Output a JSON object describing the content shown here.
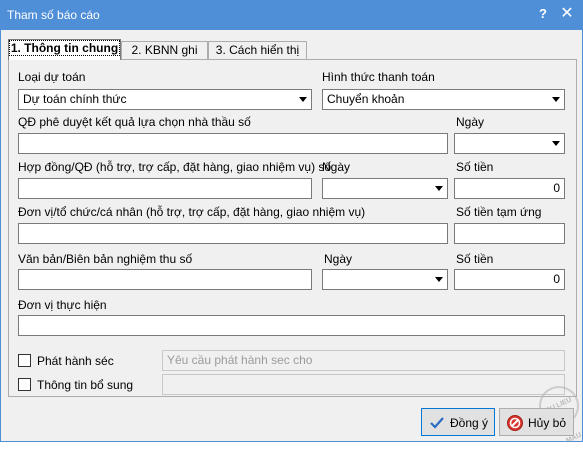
{
  "window": {
    "title": "Tham số báo cáo",
    "help_glyph": "?",
    "close_glyph": "✕",
    "title_color": "#4f8fd8"
  },
  "tabs": [
    {
      "label": "1. Thông tin chung",
      "active": true
    },
    {
      "label": "2. KBNN ghi",
      "active": false
    },
    {
      "label": "3. Cách hiển thị",
      "active": false
    }
  ],
  "form": {
    "loai_du_toan": {
      "label": "Loại dự toán",
      "value": "Dự toán chính thức"
    },
    "hinh_thuc_tt": {
      "label": "Hình thức thanh toán",
      "value": "Chuyển khoản"
    },
    "qd_phe_duyet": {
      "label": "QĐ phê duyệt kết quả lựa chọn nhà thầu số",
      "value": ""
    },
    "qd_ngay": {
      "label": "Ngày",
      "value": ""
    },
    "hop_dong": {
      "label": "Hợp đồng/QĐ (hỗ trợ, trợ cấp, đặt hàng, giao nhiệm vụ) số",
      "value": ""
    },
    "hop_dong_ngay": {
      "label": "Ngày",
      "value": ""
    },
    "hop_dong_so_tien": {
      "label": "Số tiền",
      "value": "0"
    },
    "don_vi_to_chuc": {
      "label": "Đơn vị/tổ chức/cá nhân (hỗ trợ, trợ cấp, đặt hàng, giao nhiệm vụ)",
      "value": ""
    },
    "so_tien_tam_ung": {
      "label": "Số tiền tạm ứng",
      "value": ""
    },
    "van_ban": {
      "label": "Văn bản/Biên bản nghiệm thu số",
      "value": ""
    },
    "van_ban_ngay": {
      "label": "Ngày",
      "value": ""
    },
    "van_ban_so_tien": {
      "label": "Số tiền",
      "value": "0"
    },
    "don_vi_thuc_hien": {
      "label": "Đơn vị thực hiện",
      "value": ""
    },
    "phat_hanh_sec": {
      "label": "Phát hành séc",
      "checked": false,
      "placeholder": "Yêu cầu phát hành sec cho",
      "value": ""
    },
    "thong_tin_bo_sung": {
      "label": "Thông tin bổ sung",
      "checked": false,
      "value": ""
    }
  },
  "buttons": {
    "ok": "Đồng ý",
    "cancel": "Hủy bỏ"
  },
  "watermark": "DU LIEU MAU"
}
